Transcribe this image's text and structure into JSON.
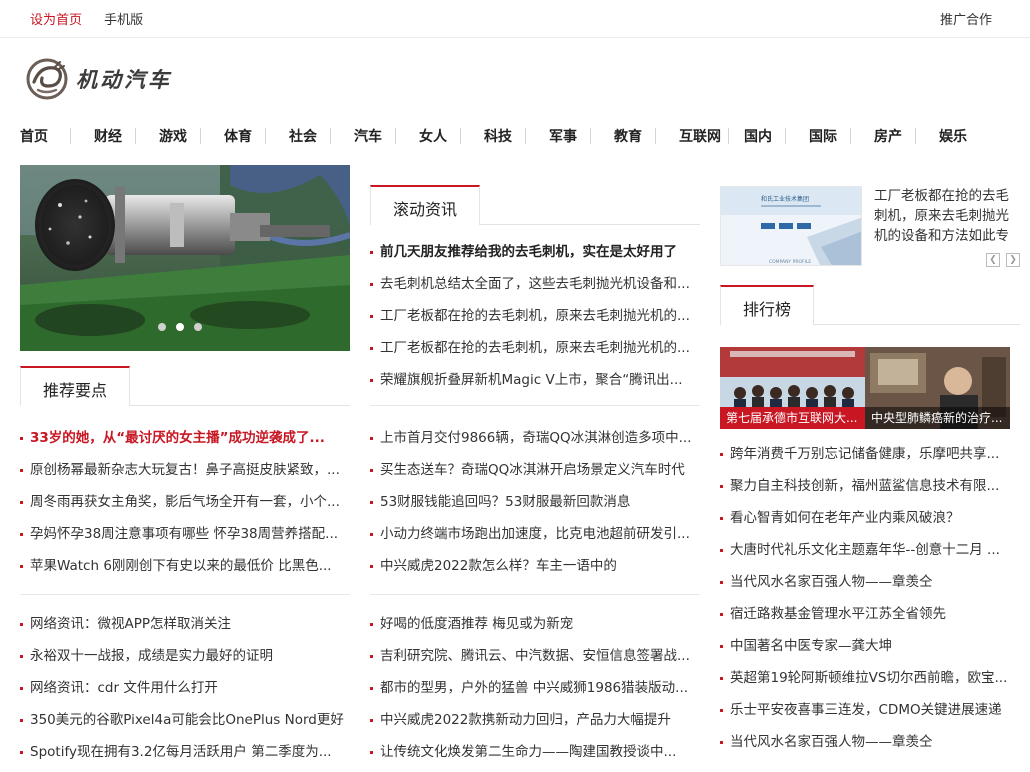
{
  "topbar": {
    "home": "设为首页",
    "mobile": "手机版",
    "promo": "推广合作"
  },
  "logo": {
    "text": "机动汽车"
  },
  "nav": [
    "首页",
    "财经",
    "游戏",
    "体育",
    "社会",
    "汽车",
    "女人",
    "科技",
    "军事",
    "教育",
    "互联网",
    "国内",
    "国际",
    "房产",
    "娱乐"
  ],
  "sections": {
    "recommend": "推荐要点",
    "rolling": "滚动资讯",
    "ranking": "排行榜"
  },
  "slider": {
    "slides": 3,
    "active": 2
  },
  "colors": {
    "accent": "#c81623"
  },
  "left_list_1": [
    "33岁的她，从“最讨厌的女主播”成功逆袭成了...",
    "原创杨幂最新杂志大玩复古！鼻子高挺皮肤紧致，...",
    "周冬雨再获女主角奖，影后气场全开有一套，小个...",
    "孕妈怀孕38周注意事项有哪些 怀孕38周营养搭配...",
    "苹果Watch 6刚刚创下有史以来的最低价 比黑色..."
  ],
  "left_list_2": [
    "网络资讯：微视APP怎样取消关注",
    "永裕双十一战报，成绩是实力最好的证明",
    "网络资讯：cdr 文件用什么打开",
    "350美元的谷歌Pixel4a可能会比OnePlus Nord更好",
    "Spotify现在拥有3.2亿每月活跃用户 第二季度为..."
  ],
  "mid_list_1": [
    "前几天朋友推荐给我的去毛刺机，实在是太好用了",
    "去毛刺机总结太全面了，这些去毛刺抛光机设备和...",
    "工厂老板都在抢的去毛刺机，原来去毛刺抛光机的...",
    "工厂老板都在抢的去毛刺机，原来去毛刺抛光机的...",
    "荣耀旗舰折叠屏新机Magic V上市，聚合“腾讯出..."
  ],
  "mid_list_2": [
    "上市首月交付9866辆，奇瑞QQ冰淇淋创造多项中...",
    "买生态送车？奇瑞QQ冰淇淋开启场景定义汽车时代",
    "53财服钱能追回吗？53财服最新回款消息",
    "小动力终端市场跑出加速度，比克电池超前研发引...",
    "中兴威虎2022款怎么样？车主一语中的"
  ],
  "mid_list_3": [
    "好喝的低度酒推荐 梅见或为新宠",
    "吉利研究院、腾讯云、中汽数据、安恒信息签署战...",
    "都市的型男，户外的猛兽 中兴威狮1986猎装版动...",
    "中兴威虎2022款携新动力回归，产品力大幅提升",
    "让传统文化焕发第二生命力——陶建国教授谈中..."
  ],
  "side_feature": {
    "text": "工厂老板都在抢的去毛刺机，原来去毛刺抛光机的设备和方法如此专",
    "thumb_title": "和氏工业技术集团",
    "thumb_caption": "COMPANY PROFILE"
  },
  "rank_captions": [
    "第七届承德市互联网大...",
    "中央型肺鳞癌新的治疗..."
  ],
  "rank_list": [
    "跨年消费千万别忘记储备健康，乐摩吧共享...",
    "聚力自主科技创新，福州蓝鲨信息技术有限...",
    "看心智青如何在老年产业内乘风破浪？",
    "大唐时代礼乐文化主题嘉年华--创意十二月 ...",
    "当代风水名家百强人物——章羡仝",
    "宿迁路救基金管理水平江苏全省领先",
    "中国著名中医专家—龚大坤",
    "英超第19轮阿斯顿维拉VS切尔西前瞻，欧宝...",
    "乐士平安夜喜事三连发，CDMO关键进展速递",
    "当代风水名家百强人物——章羡仝"
  ]
}
